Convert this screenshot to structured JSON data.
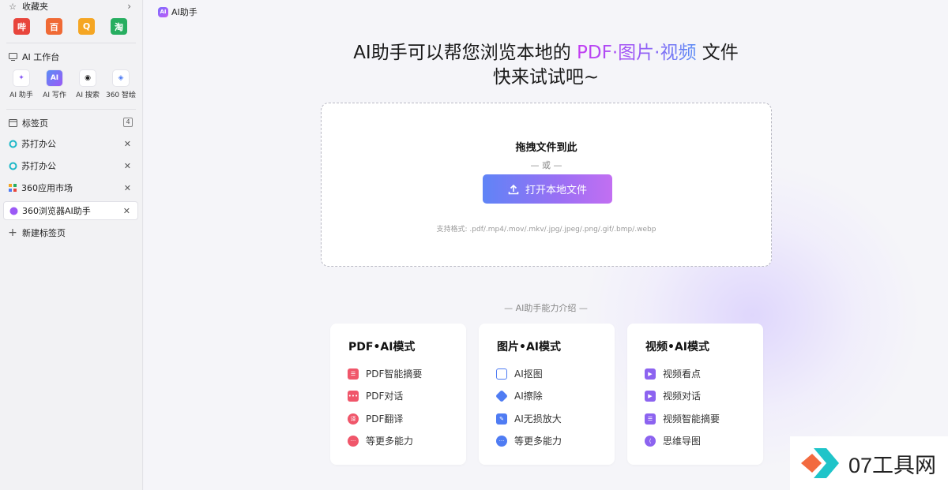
{
  "sidebar": {
    "favorites": {
      "title": "收藏夹",
      "items": [
        {
          "label": "哔",
          "color": "#e8453c"
        },
        {
          "label": "百",
          "color": "#f06a35"
        },
        {
          "label": "Q",
          "color": "#f5a623"
        },
        {
          "label": "淘",
          "color": "#27ae60"
        }
      ]
    },
    "workspace": {
      "title": "AI 工作台",
      "items": [
        {
          "label": "AI 助手"
        },
        {
          "label": "AI 写作"
        },
        {
          "label": "AI 搜索"
        },
        {
          "label": "360 智绘"
        }
      ]
    },
    "tabs": {
      "title": "标签页",
      "count": "4",
      "items": [
        {
          "label": "苏打办公"
        },
        {
          "label": "苏打办公"
        },
        {
          "label": "360应用市场"
        },
        {
          "label": "360浏览器AI助手"
        }
      ],
      "new_tab": "新建标签页"
    }
  },
  "topbar": {
    "logo": "AI",
    "title": "AI助手"
  },
  "hero": {
    "line1_prefix": "AI助手可以帮您浏览本地的 ",
    "line1_highlight": "PDF·图片·视频",
    "line1_suffix": " 文件",
    "line2": "快来试试吧~"
  },
  "dropzone": {
    "title": "拖拽文件到此",
    "or": "— 或 —",
    "button": "打开本地文件",
    "formats": "支持格式: .pdf/.mp4/.mov/.mkv/.jpg/.jpeg/.png/.gif/.bmp/.webp"
  },
  "features": {
    "title": "— AI助手能力介绍 —",
    "cards": [
      {
        "title": "PDF•AI模式",
        "items": [
          {
            "label": "PDF智能摘要",
            "color": "#f0566a"
          },
          {
            "label": "PDF对话",
            "color": "#f0566a"
          },
          {
            "label": "PDF翻译",
            "color": "#f0566a"
          },
          {
            "label": "等更多能力",
            "color": "#f0566a"
          }
        ]
      },
      {
        "title": "图片•AI模式",
        "items": [
          {
            "label": "AI抠图",
            "color": "#4f7cf3"
          },
          {
            "label": "AI擦除",
            "color": "#4f7cf3"
          },
          {
            "label": "AI无损放大",
            "color": "#4f7cf3"
          },
          {
            "label": "等更多能力",
            "color": "#4f7cf3"
          }
        ]
      },
      {
        "title": "视频•AI模式",
        "items": [
          {
            "label": "视频看点",
            "color": "#8c63f0"
          },
          {
            "label": "视频对话",
            "color": "#8c63f0"
          },
          {
            "label": "视频智能摘要",
            "color": "#8c63f0"
          },
          {
            "label": "思维导图",
            "color": "#8c63f0"
          }
        ]
      }
    ]
  },
  "watermark": {
    "text": "07工具网"
  }
}
